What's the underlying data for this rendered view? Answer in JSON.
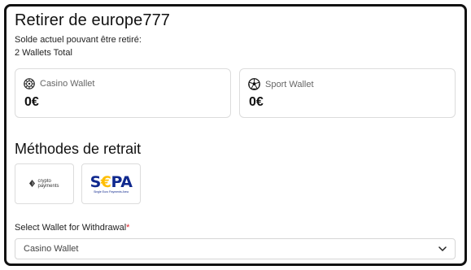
{
  "header": {
    "title": "Retirer de europe777",
    "balance_label": "Solde actuel pouvant être retiré:",
    "wallets_total": "2 Wallets Total"
  },
  "wallets": [
    {
      "name": "Casino Wallet",
      "amount": "0€",
      "icon": "roulette-chip-icon"
    },
    {
      "name": "Sport Wallet",
      "amount": "0€",
      "icon": "soccer-ball-icon"
    }
  ],
  "methods": {
    "title": "Méthodes de retrait",
    "items": [
      {
        "name": "crypto-payments",
        "logo_line1": "crypto",
        "logo_line2": "payments"
      },
      {
        "name": "sepa",
        "logo_word_left": "S",
        "logo_word_euro": "€",
        "logo_word_right": "PA",
        "logo_tagline": "Single Euro Payments Area",
        "brand_color": "#10298e",
        "accent_color": "#ffbe00"
      }
    ]
  },
  "wallet_select": {
    "label": "Select Wallet for Withdrawal",
    "required_mark": "*",
    "selected": "Casino Wallet"
  }
}
